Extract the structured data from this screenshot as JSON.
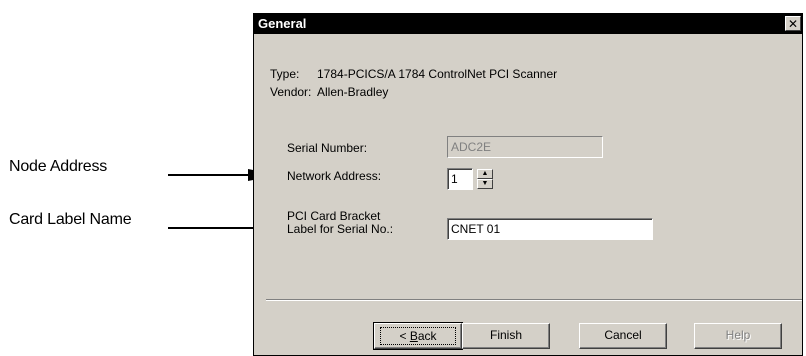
{
  "callouts": {
    "node_address": "Node Address",
    "card_label_name": "Card Label Name"
  },
  "dialog": {
    "title": "General",
    "close_glyph": "✕",
    "type_label": "Type:",
    "type_value": "1784-PCICS/A 1784 ControlNet PCI Scanner",
    "vendor_label": "Vendor:",
    "vendor_value": "Allen-Bradley",
    "serial_number_label": "Serial Number:",
    "serial_number_value": "ADC2E",
    "network_address_label": "Network Address:",
    "network_address_value": "1",
    "bracket_label_line1": "PCI Card Bracket",
    "bracket_label_line2": "Label for Serial No.:",
    "bracket_value": "CNET 01",
    "spin_up_glyph": "▲",
    "spin_down_glyph": "▼"
  },
  "buttons": {
    "back_prefix": "< ",
    "back_mnemonic": "B",
    "back_rest": "ack",
    "finish": "Finish",
    "cancel": "Cancel",
    "help": "Help"
  }
}
